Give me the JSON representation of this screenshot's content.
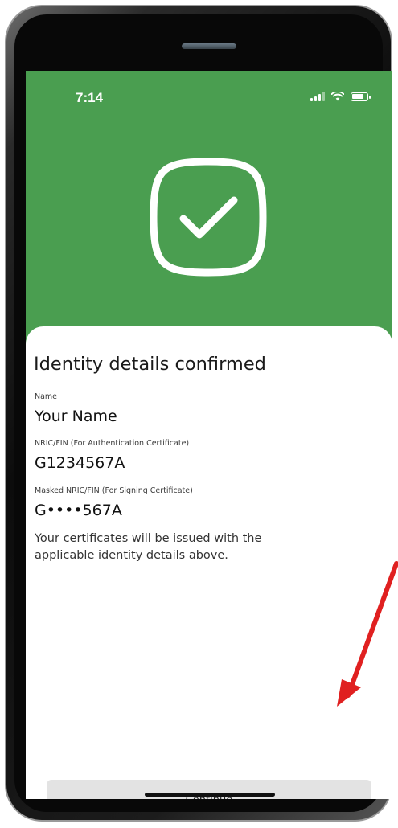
{
  "status_bar": {
    "time": "7:14",
    "icons": [
      "signal-icon",
      "wifi-icon",
      "battery-icon"
    ]
  },
  "hero": {
    "icon": "check-icon",
    "background_color": "#4a9e50"
  },
  "card": {
    "title": "Identity details confirmed",
    "fields": [
      {
        "label": "Name",
        "value": "Your Name"
      },
      {
        "label": "NRIC/FIN (For Authentication Certificate)",
        "value": "G1234567A"
      },
      {
        "label": "Masked NRIC/FIN (For Signing Certificate)",
        "value": "G••••567A"
      }
    ],
    "note": "Your certificates will be issued with the applicable identity details above."
  },
  "actions": {
    "continue_label": "Continue"
  },
  "annotation": {
    "type": "arrow-icon",
    "color": "#e02020"
  }
}
